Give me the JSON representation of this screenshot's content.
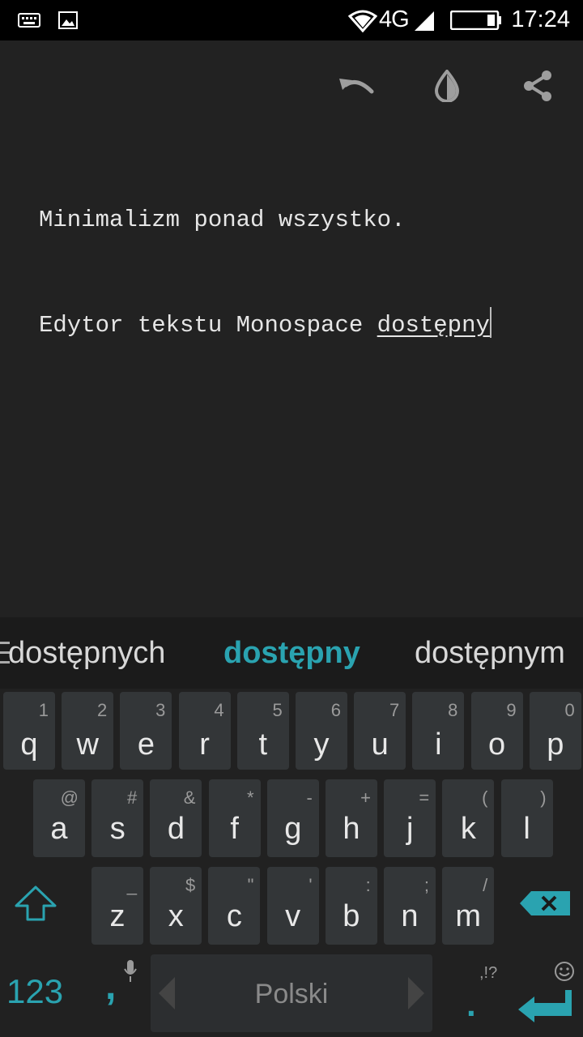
{
  "status_bar": {
    "network": "4G",
    "time": "17:24"
  },
  "toolbar": {
    "icons": [
      "undo-icon",
      "theme-contrast-icon",
      "share-icon"
    ]
  },
  "editor": {
    "line1": "Minimalizm ponad wszystko.",
    "line2_prefix": "Edytor tekstu Monospace ",
    "line2_composing": "dostępny"
  },
  "suggestions": {
    "left": "dostępnych",
    "center": "dostępny",
    "right": "dostępnym"
  },
  "keyboard": {
    "row1": [
      {
        "label": "q",
        "hint": "1"
      },
      {
        "label": "w",
        "hint": "2"
      },
      {
        "label": "e",
        "hint": "3"
      },
      {
        "label": "r",
        "hint": "4"
      },
      {
        "label": "t",
        "hint": "5"
      },
      {
        "label": "y",
        "hint": "6"
      },
      {
        "label": "u",
        "hint": "7"
      },
      {
        "label": "i",
        "hint": "8"
      },
      {
        "label": "o",
        "hint": "9"
      },
      {
        "label": "p",
        "hint": "0"
      }
    ],
    "row2": [
      {
        "label": "a",
        "hint": "@"
      },
      {
        "label": "s",
        "hint": "#"
      },
      {
        "label": "d",
        "hint": "&"
      },
      {
        "label": "f",
        "hint": "*"
      },
      {
        "label": "g",
        "hint": "-"
      },
      {
        "label": "h",
        "hint": "+"
      },
      {
        "label": "j",
        "hint": "="
      },
      {
        "label": "k",
        "hint": "("
      },
      {
        "label": "l",
        "hint": ")"
      }
    ],
    "row3": [
      {
        "label": "z",
        "hint": "_"
      },
      {
        "label": "x",
        "hint": "$"
      },
      {
        "label": "c",
        "hint": "\""
      },
      {
        "label": "v",
        "hint": "'"
      },
      {
        "label": "b",
        "hint": ":"
      },
      {
        "label": "n",
        "hint": ";"
      },
      {
        "label": "m",
        "hint": "/"
      }
    ],
    "symbols_label": "123",
    "comma_label": ",",
    "space_label": "Polski",
    "period_label": ".",
    "period_hint": ",!?",
    "accent_color": "#2aa3b0"
  }
}
